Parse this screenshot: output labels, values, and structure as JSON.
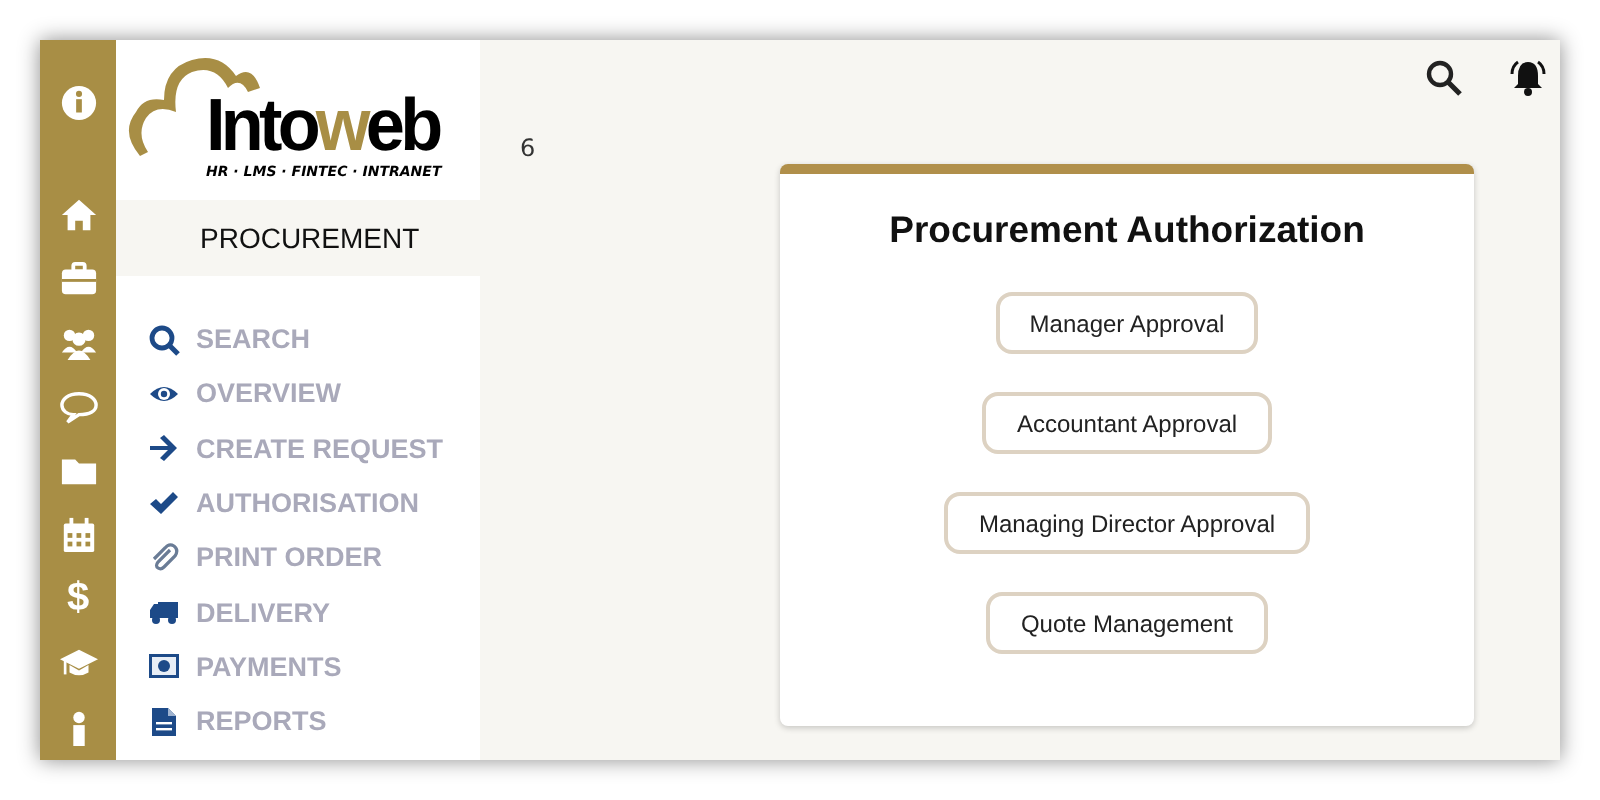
{
  "rail": {
    "dollar_glyph": "$"
  },
  "logo": {
    "brand_start": "Into",
    "brand_accent": "w",
    "brand_end": "eb",
    "tagline": "HR · LMS · FINTEC · INTRANET",
    "badge": "6"
  },
  "module": {
    "title": "PROCUREMENT"
  },
  "menu": [
    {
      "label": "SEARCH",
      "kind": "search"
    },
    {
      "label": "OVERVIEW",
      "kind": "eye"
    },
    {
      "label": "CREATE REQUEST",
      "kind": "arrow"
    },
    {
      "label": "AUTHORISATION",
      "kind": "check"
    },
    {
      "label": "PRINT ORDER",
      "kind": "clip"
    },
    {
      "label": "DELIVERY",
      "kind": "truck"
    },
    {
      "label": "PAYMENTS",
      "kind": "money"
    },
    {
      "label": "REPORTS",
      "kind": "doc"
    }
  ],
  "card": {
    "title": "Procurement Authorization",
    "buttons": [
      "Manager Approval",
      "Accountant Approval",
      "Managing Director Approval",
      "Quote Management"
    ]
  }
}
